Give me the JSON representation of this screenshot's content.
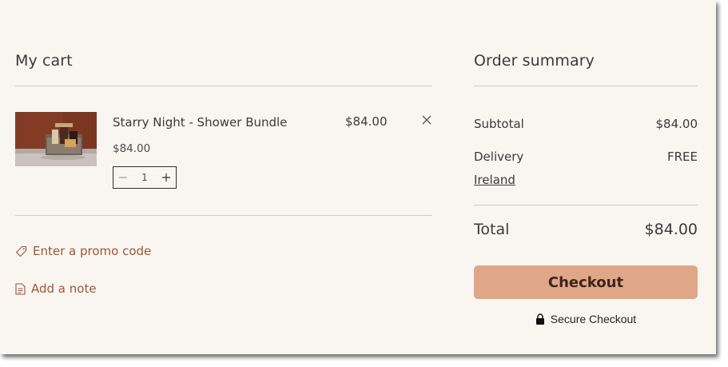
{
  "cart": {
    "title": "My cart",
    "items": [
      {
        "name": "Starry Night - Shower Bundle",
        "unit_price": "$84.00",
        "line_price": "$84.00",
        "quantity": "1"
      }
    ],
    "promo_label": "Enter a promo code",
    "note_label": "Add a note"
  },
  "summary": {
    "title": "Order summary",
    "subtotal_label": "Subtotal",
    "subtotal_value": "$84.00",
    "delivery_label": "Delivery",
    "delivery_value": "FREE",
    "delivery_region": "Ireland",
    "total_label": "Total",
    "total_value": "$84.00",
    "checkout_label": "Checkout",
    "secure_label": "Secure Checkout"
  },
  "icons": {
    "remove": "close-icon",
    "minus": "minus-icon",
    "plus": "plus-icon",
    "promo": "tag-icon",
    "note": "note-icon",
    "secure": "lock-icon"
  },
  "colors": {
    "background": "#f9f6f2",
    "accent_link": "#a05433",
    "checkout_button": "#e0a688",
    "checkout_text": "#3d2418",
    "divider": "#cfcac4"
  }
}
